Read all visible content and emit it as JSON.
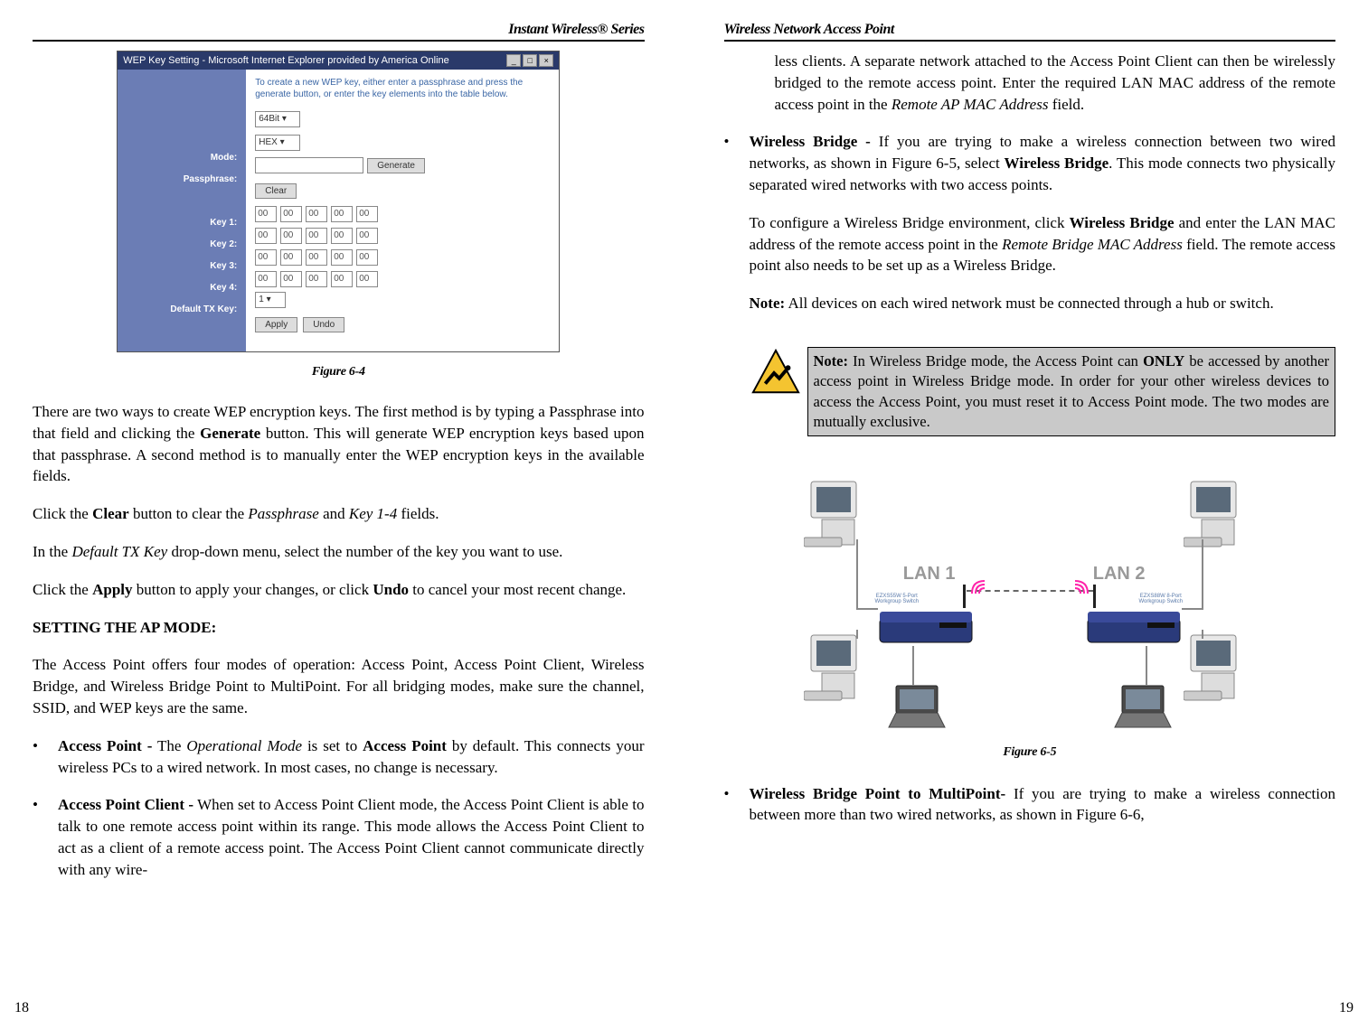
{
  "left_header": "Instant Wireless® Series",
  "right_header": "Wireless Network Access Point",
  "left_page_num": "18",
  "right_page_num": "19",
  "fig64": {
    "caption": "Figure 6-4",
    "title": "WEP Key Setting - Microsoft Internet Explorer provided by America Online",
    "instruction": "To create a new WEP key, either enter a passphrase and press the generate button, or enter the key elements into the table below.",
    "bits": "64Bit",
    "mode_label": "Mode:",
    "mode_val": "HEX",
    "passphrase_label": "Passphrase:",
    "generate": "Generate",
    "clear": "Clear",
    "k1": "Key 1:",
    "k2": "Key 2:",
    "k3": "Key 3:",
    "k4": "Key 4:",
    "keyval": "00",
    "defkey_label": "Default TX Key:",
    "defkey_val": "1",
    "apply": "Apply",
    "undo": "Undo",
    "winmin": "_",
    "winmax": "□",
    "winclose": "×"
  },
  "left": {
    "p1": "There are two ways to create WEP encryption keys. The first method is by typing a Passphrase into that field and clicking the <b>Generate</b> button. This will generate WEP encryption keys based upon that passphrase. A second method is to manually enter the WEP encryption keys in the available fields.",
    "p2": "Click the <b>Clear</b> button to clear the <i>Passphrase</i> and <i>Key 1-4</i> fields.",
    "p3": "In the <i>Default TX Key</i> drop-down menu, select the number of the key you want to use.",
    "p4": "Click the <b>Apply</b> button to apply your changes, or click <b>Undo</b> to cancel your most recent change.",
    "heading": "SETTING THE AP MODE:",
    "p5": "The Access Point offers four modes of operation: Access Point, Access Point Client, Wireless Bridge, and Wireless Bridge Point to MultiPoint. For all bridging modes, make sure the channel, SSID, and WEP keys are the same.",
    "b1": "<b>Access Point -</b> The <i>Operational Mode</i> is set to <b>Access Point</b> by default. This connects your wireless PCs to a wired network. In most cases, no change is necessary.",
    "b2": "<b>Access Point Client -</b> When set to Access Point Client mode, the Access Point Client is able to talk to one remote access point within its range. This mode allows the Access Point Client to act as a client of a remote access point. The Access Point Client cannot communicate directly with any wire-"
  },
  "right": {
    "p1": "less clients. A separate network attached to the Access Point Client can then be wirelessly bridged to the remote access point. Enter the required LAN MAC address of the remote access point in the <i>Remote AP MAC Address</i> field.",
    "b1a": "<b>Wireless Bridge -</b> If you are trying to make a wireless connection between two wired networks, as shown in Figure 6-5, select <b>Wireless Bridge</b>. This mode connects two physically separated wired networks with two access points.",
    "b1b": "To configure a Wireless Bridge environment, click <b>Wireless Bridge</b> and enter the LAN MAC address of the remote access point in the <i>Remote Bridge MAC Address</i> field. The remote access point also needs to be set up as a Wireless Bridge.",
    "b1c": "<b>Note:</b> All devices on each wired network must be connected through a hub or switch.",
    "note": "<b>Note:</b> In Wireless Bridge mode, the Access Point can <b>ONLY</b> be accessed by another access point in Wireless Bridge mode. In order for your other wireless devices to access the Access Point, you must reset it to Access Point mode.  The two modes are mutually exclusive.",
    "b2": "<b>Wireless Bridge Point to MultiPoint-</b> If you are trying to make a wireless connection between more than two wired networks, as shown in Figure 6-6,"
  },
  "fig65": {
    "caption": "Figure 6-5",
    "lan1": "LAN 1",
    "lan2": "LAN 2",
    "switch1": "EZXS55W 5-Port Workgroup Switch",
    "switch2": "EZXS88W 8-Port Workgroup Switch"
  }
}
